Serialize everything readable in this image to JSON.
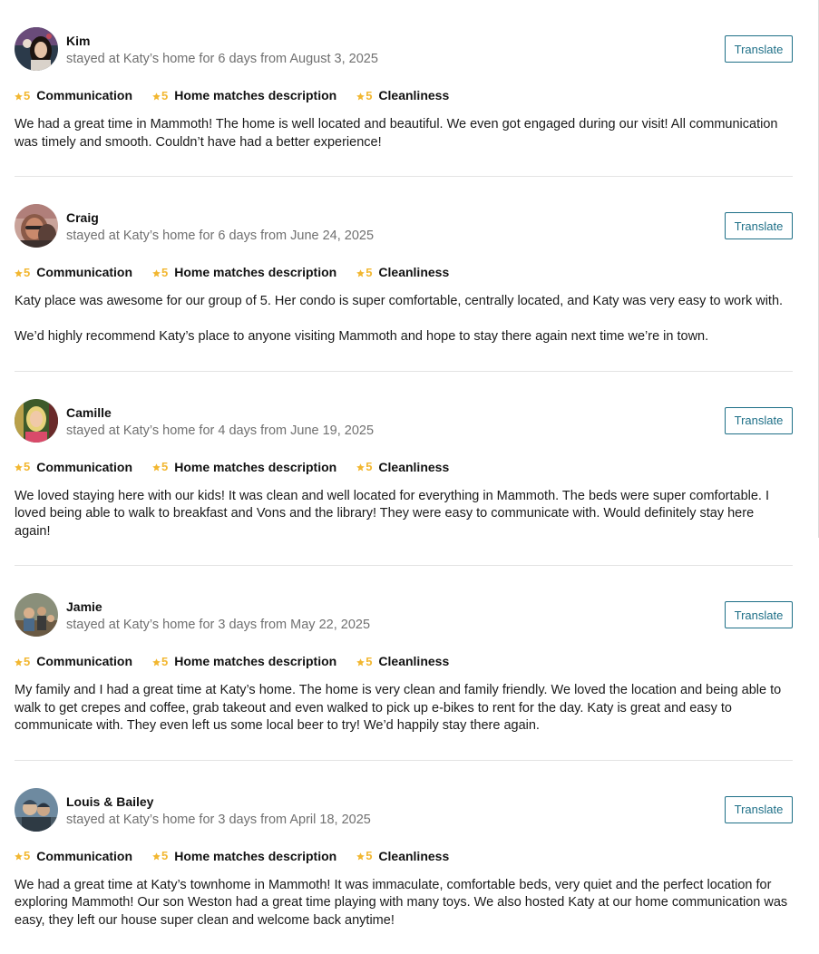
{
  "colors": {
    "star": "#f2b731",
    "translate_border": "#1e6f87",
    "translate_text": "#1e6f87",
    "divider": "#e4e4e4",
    "meta_text": "#707070"
  },
  "rating_icon": "star-icon",
  "reviews": [
    {
      "name": "Kim",
      "stay": "stayed at Katy’s home for 6 days from August 3, 2025",
      "translate_label": "Translate",
      "ratings": [
        {
          "score": "5",
          "label": "Communication"
        },
        {
          "score": "5",
          "label": "Home matches description"
        },
        {
          "score": "5",
          "label": "Cleanliness"
        }
      ],
      "paragraphs": [
        "We had a great time in Mammoth! The home is well located and beautiful. We even got engaged during our visit! All communication was timely and smooth. Couldn’t have had a better experience!"
      ]
    },
    {
      "name": "Craig",
      "stay": "stayed at Katy’s home for 6 days from June 24, 2025",
      "translate_label": "Translate",
      "ratings": [
        {
          "score": "5",
          "label": "Communication"
        },
        {
          "score": "5",
          "label": "Home matches description"
        },
        {
          "score": "5",
          "label": "Cleanliness"
        }
      ],
      "paragraphs": [
        "Katy place was awesome for our group of 5. Her condo is super comfortable, centrally located, and Katy was very easy to work with.",
        "We’d highly recommend Katy’s place to anyone visiting Mammoth and hope to stay there again next time we’re in town."
      ]
    },
    {
      "name": "Camille",
      "stay": "stayed at Katy’s home for 4 days from June 19, 2025",
      "translate_label": "Translate",
      "ratings": [
        {
          "score": "5",
          "label": "Communication"
        },
        {
          "score": "5",
          "label": "Home matches description"
        },
        {
          "score": "5",
          "label": "Cleanliness"
        }
      ],
      "paragraphs": [
        "We loved staying here with our kids! It was clean and well located for everything in Mammoth. The beds were super comfortable. I loved being able to walk to breakfast and Vons and the library! They were easy to communicate with. Would definitely stay here again!"
      ]
    },
    {
      "name": "Jamie",
      "stay": "stayed at Katy’s home for 3 days from May 22, 2025",
      "translate_label": "Translate",
      "ratings": [
        {
          "score": "5",
          "label": "Communication"
        },
        {
          "score": "5",
          "label": "Home matches description"
        },
        {
          "score": "5",
          "label": "Cleanliness"
        }
      ],
      "paragraphs": [
        "My family and I had a great time at Katy’s home. The home is very clean and family friendly. We loved the location and being able to walk to get crepes and coffee, grab takeout and even walked to pick up e-bikes to rent for the day. Katy is great and easy to communicate with. They even left us some local beer to try! We’d happily stay there again."
      ]
    },
    {
      "name": "Louis & Bailey",
      "stay": "stayed at Katy’s home for 3 days from April 18, 2025",
      "translate_label": "Translate",
      "ratings": [
        {
          "score": "5",
          "label": "Communication"
        },
        {
          "score": "5",
          "label": "Home matches description"
        },
        {
          "score": "5",
          "label": "Cleanliness"
        }
      ],
      "paragraphs": [
        "We had a great time at Katy’s townhome in Mammoth! It was immaculate, comfortable beds, very quiet and the perfect location for exploring Mammoth! Our son Weston had a great time playing with many toys. We also hosted Katy at our home communication was easy, they left our house super clean and welcome back anytime!"
      ]
    }
  ]
}
